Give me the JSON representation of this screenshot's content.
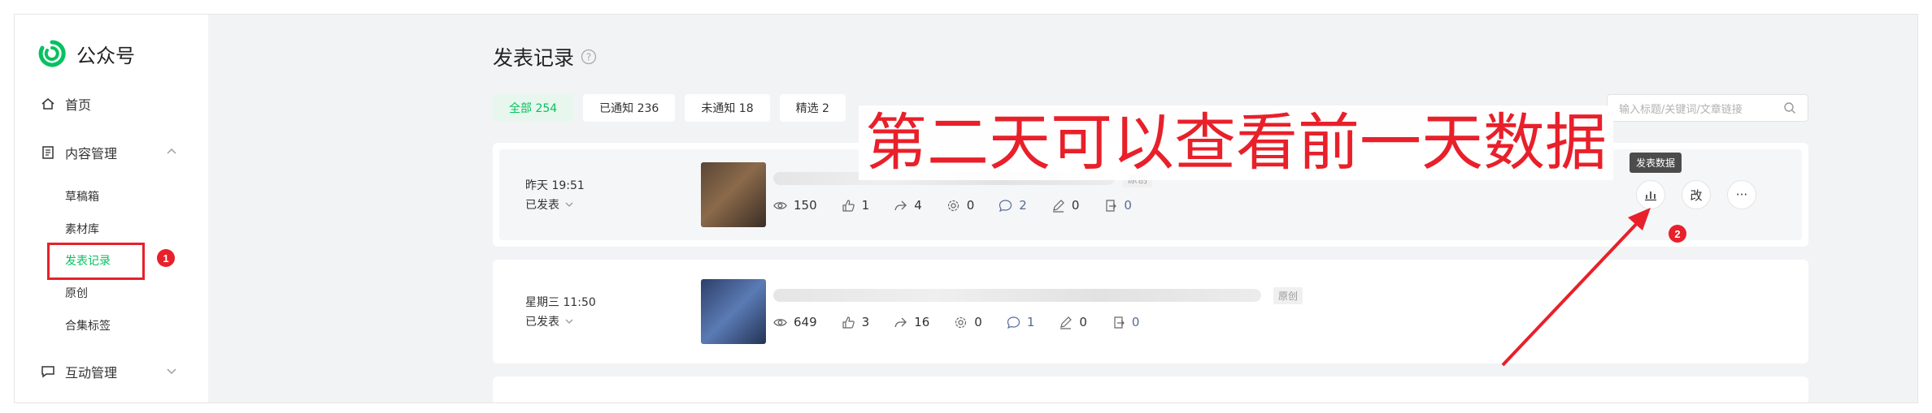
{
  "app": {
    "logo_text": "公众号"
  },
  "sidebar": {
    "home": "首页",
    "content_mgmt": "内容管理",
    "sub_items": [
      "草稿箱",
      "素材库",
      "发表记录",
      "原创",
      "合集标签"
    ],
    "interaction_mgmt": "互动管理",
    "badge_1": "1"
  },
  "page": {
    "title": "发表记录"
  },
  "filters": [
    "全部 254",
    "已通知 236",
    "未通知 18",
    "精选 2"
  ],
  "search": {
    "placeholder": "输入标题/关键词/文章链接"
  },
  "articles": [
    {
      "time": "昨天 19:51",
      "status": "已发表",
      "tag": "原创",
      "stats": {
        "views": "150",
        "likes": "1",
        "shares": "4",
        "wow": "0",
        "comments": "2",
        "notes": "0",
        "follows": "0"
      }
    },
    {
      "time": "星期三 11:50",
      "status": "已发表",
      "tag": "原创",
      "stats": {
        "views": "649",
        "likes": "3",
        "shares": "16",
        "wow": "0",
        "comments": "1",
        "notes": "0",
        "follows": "0"
      }
    }
  ],
  "actions": {
    "tooltip": "发表数据",
    "edit_label": "改",
    "more_label": "···",
    "badge_2": "2"
  },
  "annotation": {
    "text": "第二天可以查看前一天数据"
  },
  "colors": {
    "accent": "#07c160",
    "annotation": "#e8202a",
    "link": "#576b95"
  }
}
